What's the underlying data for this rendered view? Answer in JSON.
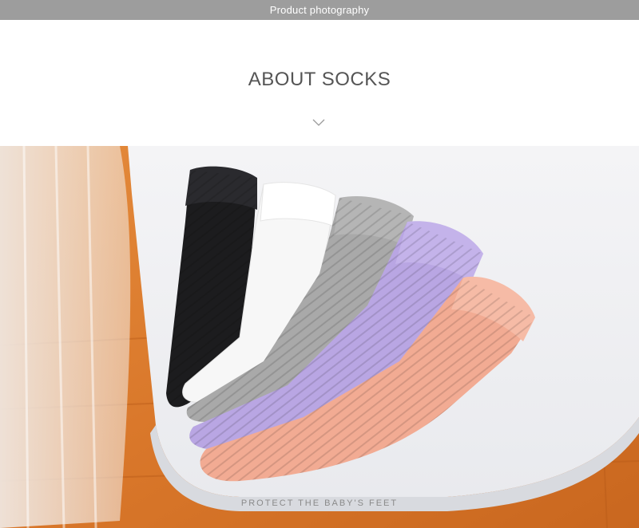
{
  "header": {
    "bar_text": "Product photography",
    "bar_color": "#9d9d9d"
  },
  "section": {
    "title": "ABOUT SOCKS",
    "divider_icon": "chevron-down-icon"
  },
  "photo": {
    "subject": "five knee-high knit baby socks on a white chair",
    "sock_colors": [
      "#1c1c1e",
      "#f7f7f7",
      "#a9a9a9",
      "#b9a6e3",
      "#f2ab93"
    ],
    "caption": "PROTECT THE BABY'S FEET"
  }
}
